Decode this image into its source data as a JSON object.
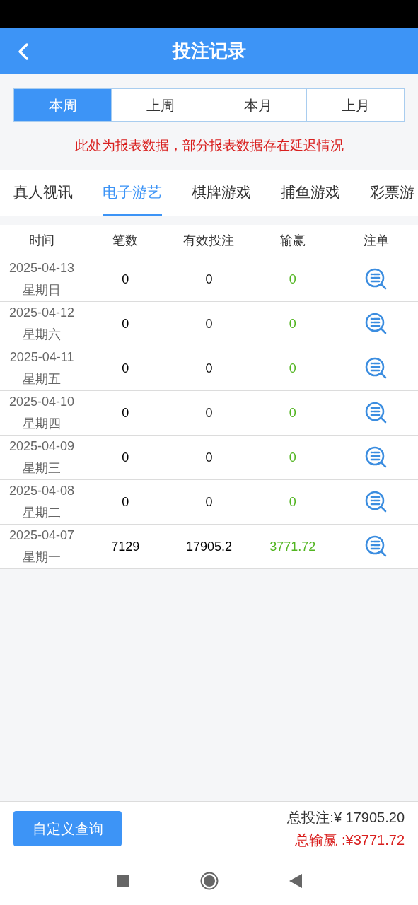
{
  "header": {
    "title": "投注记录"
  },
  "periods": [
    {
      "label": "本周",
      "selected": true
    },
    {
      "label": "上周",
      "selected": false
    },
    {
      "label": "本月",
      "selected": false
    },
    {
      "label": "上月",
      "selected": false
    }
  ],
  "notice": "此处为报表数据，部分报表数据存在延迟情况",
  "categories": [
    {
      "label": "真人视讯",
      "selected": false
    },
    {
      "label": "电子游艺",
      "selected": true
    },
    {
      "label": "棋牌游戏",
      "selected": false
    },
    {
      "label": "捕鱼游戏",
      "selected": false
    },
    {
      "label": "彩票游",
      "selected": false
    }
  ],
  "table": {
    "columns": [
      "时间",
      "笔数",
      "有效投注",
      "输赢",
      "注单"
    ],
    "rows": [
      {
        "date": "2025-04-13",
        "weekday": "星期日",
        "count": "0",
        "valid_bet": "0",
        "win_loss": "0"
      },
      {
        "date": "2025-04-12",
        "weekday": "星期六",
        "count": "0",
        "valid_bet": "0",
        "win_loss": "0"
      },
      {
        "date": "2025-04-11",
        "weekday": "星期五",
        "count": "0",
        "valid_bet": "0",
        "win_loss": "0"
      },
      {
        "date": "2025-04-10",
        "weekday": "星期四",
        "count": "0",
        "valid_bet": "0",
        "win_loss": "0"
      },
      {
        "date": "2025-04-09",
        "weekday": "星期三",
        "count": "0",
        "valid_bet": "0",
        "win_loss": "0"
      },
      {
        "date": "2025-04-08",
        "weekday": "星期二",
        "count": "0",
        "valid_bet": "0",
        "win_loss": "0"
      },
      {
        "date": "2025-04-07",
        "weekday": "星期一",
        "count": "7129",
        "valid_bet": "17905.2",
        "win_loss": "3771.72"
      }
    ]
  },
  "footer": {
    "button": "自定义查询",
    "total_bet": "总投注:¥ 17905.20",
    "total_win": "总输赢 :¥3771.72"
  }
}
